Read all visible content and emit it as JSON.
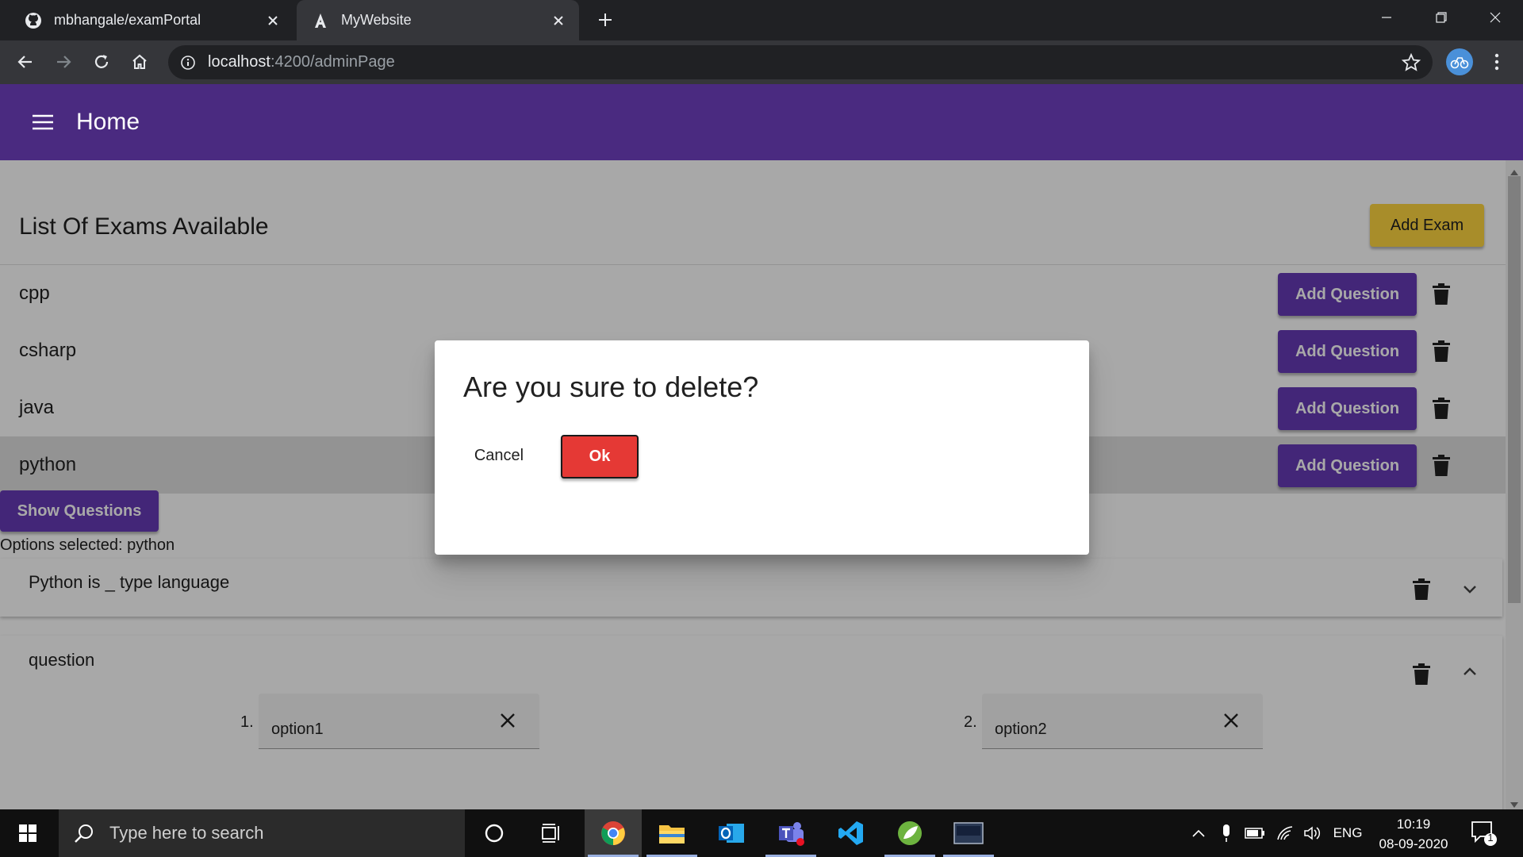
{
  "browser": {
    "tabs": [
      {
        "title": "mbhangale/examPortal",
        "icon": "github-icon",
        "active": false
      },
      {
        "title": "MyWebsite",
        "icon": "angular-icon",
        "active": true
      }
    ],
    "url_host": "localhost",
    "url_path": ":4200/adminPage"
  },
  "app": {
    "header_title": "Home",
    "list_title": "List Of Exams Available",
    "add_exam_label": "Add Exam",
    "exams": [
      {
        "name": "cpp",
        "add_question_label": "Add Question",
        "selected": false
      },
      {
        "name": "csharp",
        "add_question_label": "Add Question",
        "selected": false
      },
      {
        "name": "java",
        "add_question_label": "Add Question",
        "selected": false
      },
      {
        "name": "python",
        "add_question_label": "Add Question",
        "selected": true
      }
    ],
    "show_questions_label": "Show Questions",
    "options_selected": "Options selected: python",
    "questions": [
      {
        "title": "Python is _ type language",
        "expanded": false
      },
      {
        "title": "question",
        "expanded": true,
        "options": [
          {
            "number": "1.",
            "value": "option1"
          },
          {
            "number": "2.",
            "value": "option2"
          }
        ]
      }
    ]
  },
  "dialog": {
    "title": "Are you sure to delete?",
    "cancel_label": "Cancel",
    "ok_label": "Ok"
  },
  "taskbar": {
    "search_placeholder": "Type here to search",
    "language": "ENG",
    "time": "10:19",
    "date": "08-09-2020",
    "notification_count": "1"
  },
  "colors": {
    "primary": "#673ab7",
    "accent": "#ffd740",
    "warn": "#e53935",
    "header": "#4a2a80"
  }
}
